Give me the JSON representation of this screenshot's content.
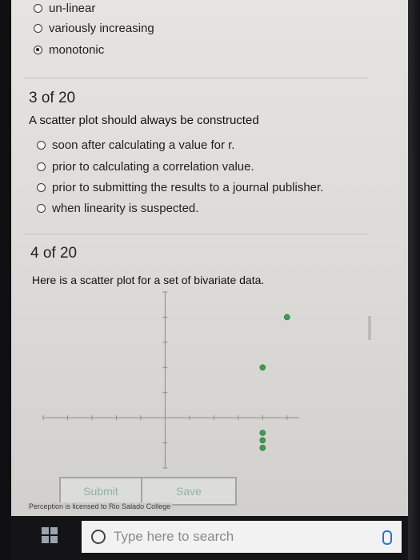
{
  "q2_options": [
    {
      "label": "un-linear",
      "selected": false
    },
    {
      "label": "variously increasing",
      "selected": false
    },
    {
      "label": "monotonic",
      "selected": true
    }
  ],
  "q3": {
    "number": "3 of 20",
    "text": "A scatter plot should always be constructed",
    "options": [
      {
        "label": "soon after calculating a value for r."
      },
      {
        "label": "prior to calculating a correlation value."
      },
      {
        "label": "prior to submitting the results to a journal publisher."
      },
      {
        "label": "when linearity is suspected."
      }
    ]
  },
  "q4": {
    "number": "4 of 20",
    "text": "Here is a scatter plot for a set of bivariate data."
  },
  "chart_data": {
    "type": "scatter",
    "x": [
      5,
      4,
      4,
      4,
      4
    ],
    "y": [
      4,
      2,
      -0.6,
      -0.9,
      -1.2
    ],
    "xlim": [
      -5,
      5.5
    ],
    "ylim": [
      -2,
      5
    ],
    "grid": false,
    "point_color": "#3f9a55"
  },
  "buttons": {
    "submit": "Submit",
    "save": "Save"
  },
  "footer": {
    "note": "Perception is licensed to Rio Salado College"
  },
  "taskbar": {
    "search_placeholder": "Type here to search"
  }
}
